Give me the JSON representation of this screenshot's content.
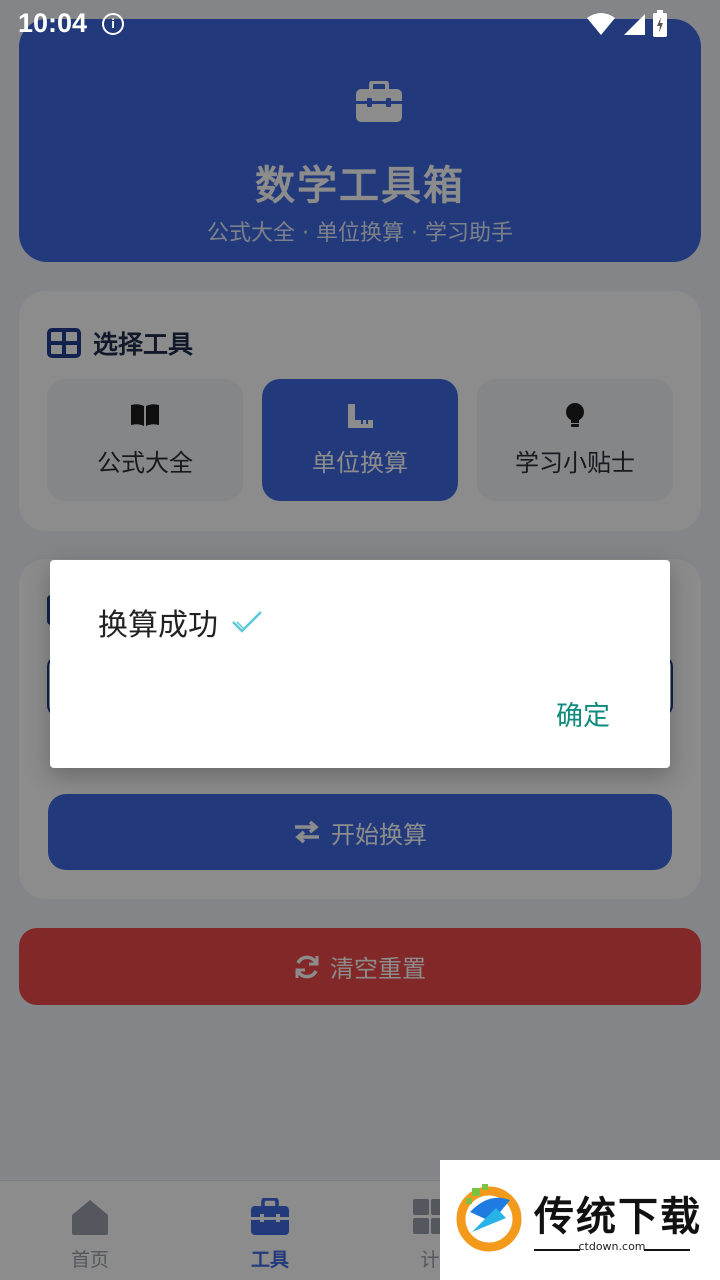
{
  "status_bar": {
    "time": "10:04",
    "info_glyph": "i"
  },
  "header": {
    "icon": "toolbox-icon",
    "title": "数学工具箱",
    "subtitle": "公式大全 · 单位换算 · 学习助手"
  },
  "tools_section": {
    "icon": "grid-icon",
    "title": "选择工具",
    "items": [
      {
        "label": "公式大全",
        "icon": "book-icon",
        "active": false
      },
      {
        "label": "单位换算",
        "icon": "ruler-icon",
        "active": true
      },
      {
        "label": "学习小贴士",
        "icon": "lightbulb-icon",
        "active": false
      }
    ]
  },
  "convert_section": {
    "start_button": {
      "label": "开始换算",
      "icon": "swap-arrows-icon"
    }
  },
  "reset_button": {
    "label": "清空重置",
    "icon": "refresh-icon"
  },
  "bottom_nav": {
    "items": [
      {
        "label": "首页",
        "icon": "home-icon",
        "active": false
      },
      {
        "label": "工具",
        "icon": "toolbox-icon",
        "active": true
      },
      {
        "label": "计",
        "icon": "calculator-icon",
        "active": false
      }
    ]
  },
  "dialog": {
    "message": "换算成功",
    "check_icon": "check-icon",
    "ok_label": "确定"
  },
  "watermark": {
    "name": "传统下载",
    "url": "ctdown.com"
  },
  "colors": {
    "primary": "#3f6ae0",
    "danger": "#ef4a4a",
    "dialog_action": "#0f8a7e",
    "check": "#5bc8d8"
  }
}
